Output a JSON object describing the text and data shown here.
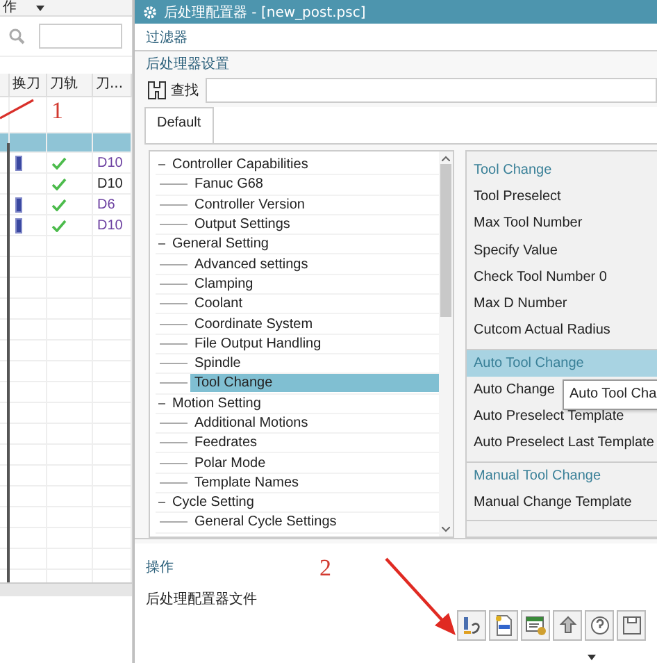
{
  "background_app": {
    "menu": "作",
    "table": {
      "columns": [
        "换刀",
        "刀轨",
        "刀..."
      ],
      "rows": [
        {
          "selected": false
        },
        {
          "selected": true
        },
        {
          "selected": false,
          "tool_icon": true,
          "check": true,
          "value": "D10",
          "color": "#6b3fa0"
        },
        {
          "selected": false,
          "tool_icon": false,
          "check": true,
          "value": "D10",
          "color": "#222222"
        },
        {
          "selected": false,
          "tool_icon": true,
          "check": true,
          "value": "D6",
          "color": "#6b3fa0"
        },
        {
          "selected": false,
          "tool_icon": true,
          "check": true,
          "value": "D10",
          "color": "#6b3fa0"
        }
      ]
    }
  },
  "window": {
    "title": "后处理配置器 - [new_post.psc]"
  },
  "filter": {
    "label": "过滤器"
  },
  "settings": {
    "label": "后处理器设置",
    "search_label": "查找",
    "tabs": [
      {
        "label": "Default",
        "selected": true
      }
    ]
  },
  "tree": [
    {
      "label": "Controller Capabilities",
      "expanded": true,
      "selected": false,
      "children": [
        {
          "label": "Fanuc G68",
          "selected": false
        },
        {
          "label": "Controller Version",
          "selected": false
        },
        {
          "label": "Output Settings",
          "selected": false
        }
      ]
    },
    {
      "label": "General Setting",
      "expanded": true,
      "selected": false,
      "children": [
        {
          "label": "Advanced settings",
          "selected": false
        },
        {
          "label": "Clamping",
          "selected": false
        },
        {
          "label": "Coolant",
          "selected": false
        },
        {
          "label": "Coordinate System",
          "selected": false
        },
        {
          "label": "File Output Handling",
          "selected": false
        },
        {
          "label": "Spindle",
          "selected": false
        },
        {
          "label": "Tool Change",
          "selected": true
        }
      ]
    },
    {
      "label": "Motion Setting",
      "expanded": true,
      "selected": false,
      "children": [
        {
          "label": "Additional Motions",
          "selected": false
        },
        {
          "label": "Feedrates",
          "selected": false
        },
        {
          "label": "Polar Mode",
          "selected": false
        },
        {
          "label": "Template Names",
          "selected": false
        }
      ]
    },
    {
      "label": "Cycle Setting",
      "expanded": true,
      "selected": false,
      "children": [
        {
          "label": "General Cycle Settings",
          "selected": false
        }
      ]
    }
  ],
  "properties": {
    "sections": [
      {
        "title": "Tool Change",
        "selected": false,
        "items": [
          "Tool Preselect",
          "Max Tool Number",
          "Specify Value",
          "Check Tool Number 0",
          "Max D Number",
          "Cutcom Actual Radius"
        ]
      },
      {
        "title": "Auto Tool Change",
        "selected": true,
        "items": [
          "Auto Change",
          "Auto Preselect Template",
          "Auto Preselect Last Template"
        ]
      },
      {
        "title": "Manual Tool Change",
        "selected": false,
        "items": [
          "Manual Change Template"
        ]
      }
    ],
    "tooltip": "Auto Tool Cha"
  },
  "operations": {
    "label": "操作",
    "file_label": "后处理配置器文件",
    "tools": [
      {
        "kind": "binding"
      },
      {
        "kind": "def"
      },
      {
        "kind": "list"
      },
      {
        "kind": "upload"
      },
      {
        "kind": "help"
      },
      {
        "kind": "save"
      }
    ]
  },
  "annotations": [
    {
      "label": "1"
    },
    {
      "label": "2"
    }
  ]
}
